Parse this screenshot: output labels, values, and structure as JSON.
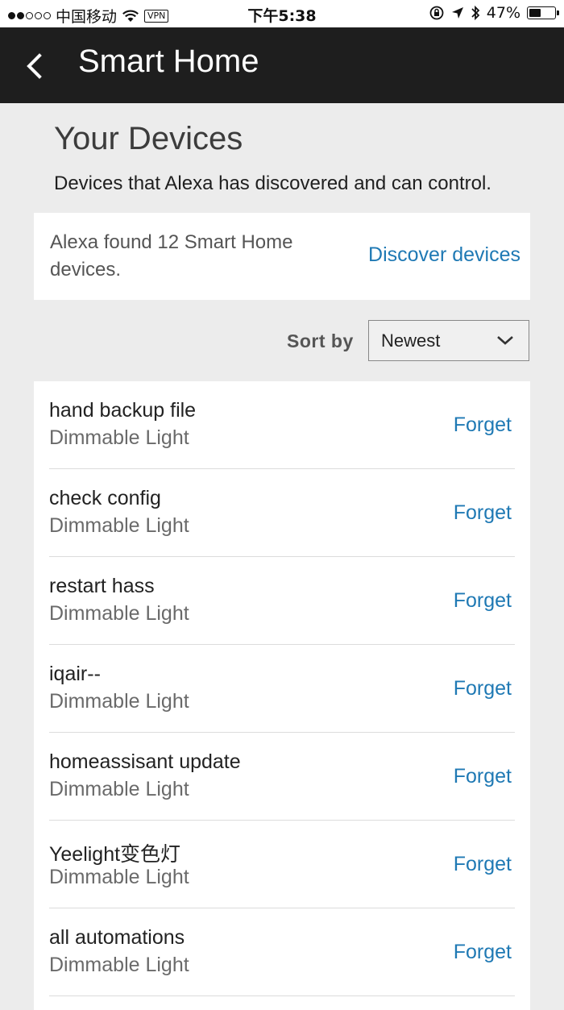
{
  "status_bar": {
    "carrier": "中国移动",
    "vpn": "VPN",
    "time": "下午5:38",
    "battery": "47%",
    "battery_level": 0.47,
    "signal_dots_filled": 2,
    "signal_dots_total": 5
  },
  "nav": {
    "title": "Smart Home",
    "back_icon": "chevron-left-icon"
  },
  "page": {
    "title": "Your Devices",
    "subtitle": "Devices that Alexa has discovered and can control."
  },
  "discovery": {
    "found_text": "Alexa found 12 Smart Home devices.",
    "discover_label": "Discover devices"
  },
  "sort": {
    "label": "Sort by",
    "selected": "Newest"
  },
  "devices": [
    {
      "name": "hand backup file",
      "type": "Dimmable Light",
      "action": "Forget"
    },
    {
      "name": "check config",
      "type": "Dimmable Light",
      "action": "Forget"
    },
    {
      "name": "restart hass",
      "type": "Dimmable Light",
      "action": "Forget"
    },
    {
      "name": "iqair--",
      "type": "Dimmable Light",
      "action": "Forget"
    },
    {
      "name": "homeassisant update",
      "type": "Dimmable Light",
      "action": "Forget"
    },
    {
      "name": "Yeelight变色灯",
      "type": "Dimmable Light",
      "action": "Forget"
    },
    {
      "name": "all automations",
      "type": "Dimmable Light",
      "action": "Forget"
    }
  ],
  "colors": {
    "accent_link": "#1f79b4",
    "nav_background": "#1e1e1e",
    "page_background": "#ececec"
  }
}
